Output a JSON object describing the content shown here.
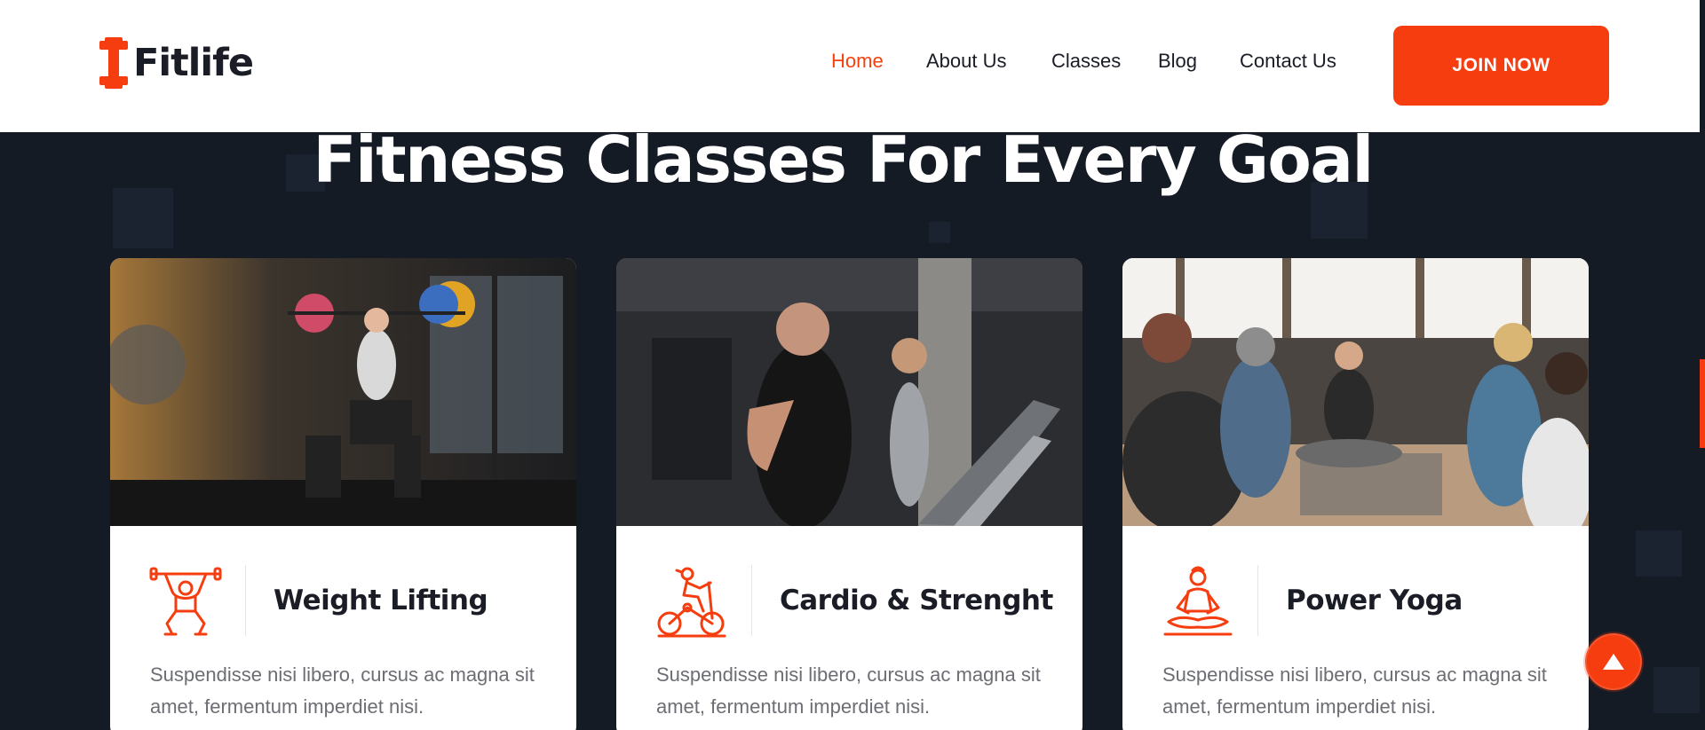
{
  "brand": {
    "name": "Fitlife",
    "accent": "#f53d0f",
    "dark": "#151b24"
  },
  "nav": {
    "items": [
      {
        "label": "Home",
        "active": true
      },
      {
        "label": "About Us"
      },
      {
        "label": "Classes"
      },
      {
        "label": "Blog"
      },
      {
        "label": "Contact Us"
      }
    ],
    "cta": "JOIN NOW"
  },
  "section": {
    "title": "Fitness Classes For Every Goal"
  },
  "cards": [
    {
      "title": "Weight Lifting",
      "desc": "Suspendisse nisi libero, cursus ac magna sit amet, fermentum imperdiet nisi.",
      "icon": "weightlifter-icon"
    },
    {
      "title": "Cardio & Strenght",
      "desc": "Suspendisse nisi libero, cursus ac magna sit amet, fermentum imperdiet nisi.",
      "icon": "exercise-bike-icon"
    },
    {
      "title": "Power Yoga",
      "desc": "Suspendisse nisi libero, cursus ac magna sit amet, fermentum imperdiet nisi.",
      "icon": "meditation-icon"
    }
  ],
  "scroll_top": {
    "icon": "arrow-up-icon"
  }
}
